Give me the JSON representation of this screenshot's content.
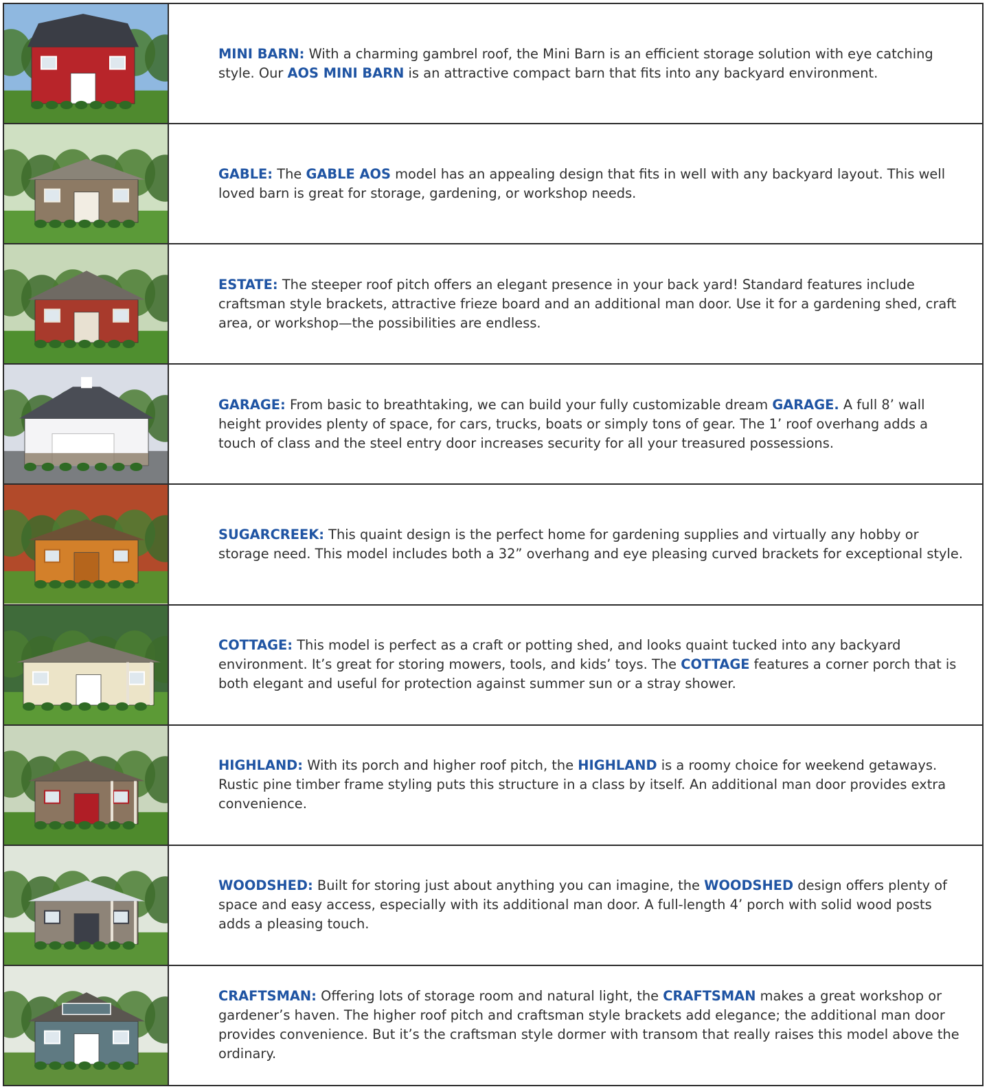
{
  "rows": [
    {
      "id": "mini-barn",
      "image": {
        "kind": "gambrel",
        "wall": "#b8252a",
        "trim": "#ffffff",
        "roof": "#3a3d45",
        "sky": "#8fb8e0",
        "ground": "#4f8a2e"
      },
      "segments": [
        {
          "t": "MINI BARN:",
          "k": true
        },
        {
          "t": " With a charming gambrel roof, the Mini Barn is an efficient storage solution with eye catching style. Our ",
          "k": false
        },
        {
          "t": "AOS MINI BARN",
          "k": true
        },
        {
          "t": " is an attractive compact barn that fits into any backyard environment.",
          "k": false
        }
      ]
    },
    {
      "id": "gable",
      "image": {
        "kind": "gable",
        "wall": "#8d7a64",
        "trim": "#f2ede3",
        "roof": "#8a8478",
        "sky": "#cfe0c2",
        "ground": "#5b9a38"
      },
      "segments": [
        {
          "t": "GABLE:",
          "k": true
        },
        {
          "t": " The ",
          "k": false
        },
        {
          "t": "GABLE AOS",
          "k": true
        },
        {
          "t": " model has an appealing design that fits in well with any backyard layout. This well loved barn is great for storage, gardening, or workshop needs.",
          "k": false
        }
      ]
    },
    {
      "id": "estate",
      "image": {
        "kind": "gable-steep",
        "wall": "#a83a2c",
        "trim": "#e8e1d2",
        "roof": "#6f6a63",
        "sky": "#c7d8b8",
        "ground": "#4f8f2f"
      },
      "segments": [
        {
          "t": "ESTATE:",
          "k": true
        },
        {
          "t": " The steeper roof pitch offers an elegant presence in your back yard! Standard features include craftsman style brackets, attractive frieze board and an additional man door. Use it for a gardening shed, craft area, or workshop—the possibilities are endless.",
          "k": false
        }
      ]
    },
    {
      "id": "garage",
      "image": {
        "kind": "garage",
        "wall": "#f4f4f6",
        "trim": "#ffffff",
        "roof": "#4a4d55",
        "sky": "#d9dde6",
        "ground": "#7a7d80"
      },
      "segments": [
        {
          "t": "GARAGE:",
          "k": true
        },
        {
          "t": " From basic to breathtaking, we can build your fully customizable dream ",
          "k": false
        },
        {
          "t": "GARAGE.",
          "k": true
        },
        {
          "t": " A full 8’ wall height provides plenty of space, for cars, trucks, boats or simply tons of gear. The 1’ roof overhang adds a touch of class and the steel entry door increases security for all your treasured possessions.",
          "k": false
        }
      ]
    },
    {
      "id": "sugarcreek",
      "image": {
        "kind": "gable",
        "wall": "#d3802a",
        "trim": "#b5651c",
        "roof": "#6e5236",
        "sky": "#b24a2a",
        "ground": "#5a8f2e"
      },
      "segments": [
        {
          "t": "SUGARCREEK:",
          "k": true
        },
        {
          "t": " This quaint design is the perfect home for gardening supplies and virtually any hobby or storage need. This model includes both a 32” overhang and eye pleasing curved brackets for exceptional style.",
          "k": false
        }
      ]
    },
    {
      "id": "cottage",
      "image": {
        "kind": "cottage",
        "wall": "#ece4c8",
        "trim": "#ffffff",
        "roof": "#7d776c",
        "sky": "#3f6b3a",
        "ground": "#5c9a36"
      },
      "segments": [
        {
          "t": "COTTAGE:",
          "k": true
        },
        {
          "t": " This model is perfect as a craft or potting shed, and looks quaint tucked into any backyard environment. It’s great for storing mowers, tools, and kids’ toys. The ",
          "k": false
        },
        {
          "t": "COTTAGE",
          "k": true
        },
        {
          "t": " features a corner porch that is both elegant and useful for protection against summer sun or a stray shower.",
          "k": false
        }
      ]
    },
    {
      "id": "highland",
      "image": {
        "kind": "porch",
        "wall": "#8b7560",
        "trim": "#b01e26",
        "roof": "#6a5f52",
        "sky": "#c9d6bd",
        "ground": "#4e8a2c"
      },
      "segments": [
        {
          "t": "HIGHLAND:",
          "k": true
        },
        {
          "t": " With its porch and higher roof pitch, the ",
          "k": false
        },
        {
          "t": "HIGHLAND",
          "k": true
        },
        {
          "t": " is a roomy choice for weekend getaways. Rustic pine timber frame styling puts this structure in a class by itself. An additional man door provides extra convenience.",
          "k": false
        }
      ]
    },
    {
      "id": "woodshed",
      "image": {
        "kind": "porch",
        "wall": "#8e8478",
        "trim": "#3c3f48",
        "roof": "#d8dde2",
        "sky": "#dfe6da",
        "ground": "#5a9437"
      },
      "segments": [
        {
          "t": "WOODSHED:",
          "k": true
        },
        {
          "t": " Built for storing just about anything you can imagine, the ",
          "k": false
        },
        {
          "t": "WOODSHED",
          "k": true
        },
        {
          "t": " design offers plenty of space and easy access, especially with its additional man door. A full-length 4’ porch with solid wood posts adds a pleasing touch.",
          "k": false
        }
      ]
    },
    {
      "id": "craftsman",
      "image": {
        "kind": "dormer",
        "wall": "#5f7a82",
        "trim": "#ffffff",
        "roof": "#5a5650",
        "sky": "#e4e9e0",
        "ground": "#5f8f3a"
      },
      "segments": [
        {
          "t": "CRAFTSMAN:",
          "k": true
        },
        {
          "t": " Offering lots of storage room and natural light, the ",
          "k": false
        },
        {
          "t": "CRAFTSMAN",
          "k": true
        },
        {
          "t": " makes a great workshop or gardener’s haven. The higher roof pitch and craftsman style brackets add elegance; the additional man door provides convenience. But it’s the craftsman style dormer with transom that really raises this model above the ordinary.",
          "k": false
        }
      ]
    }
  ]
}
